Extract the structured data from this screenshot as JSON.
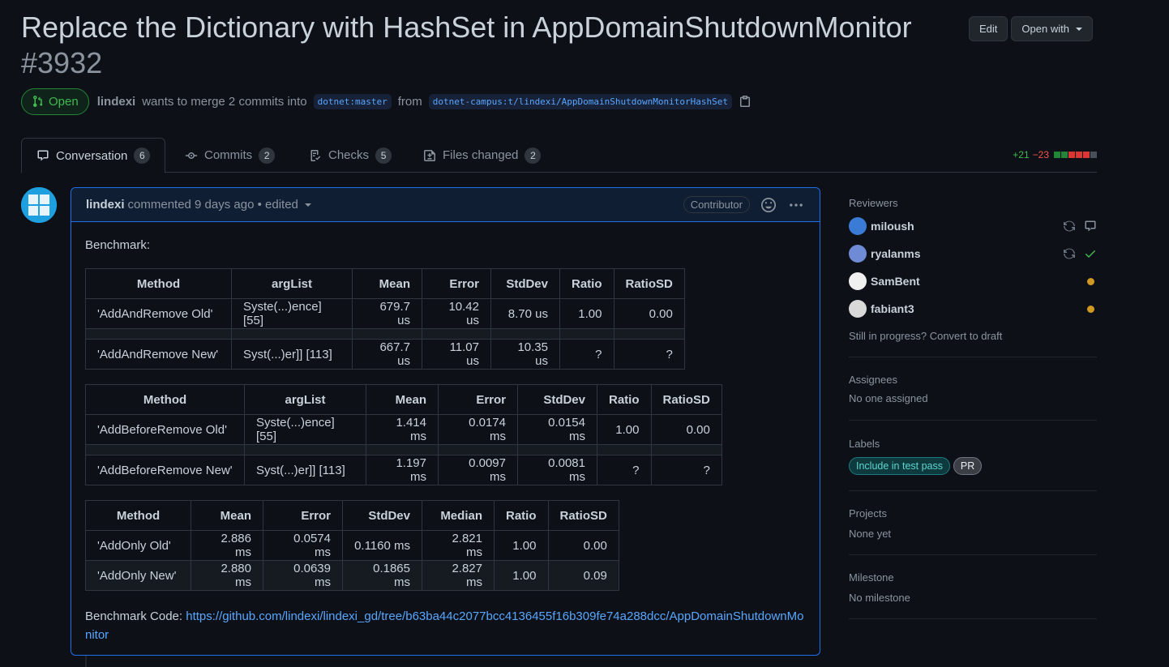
{
  "pr": {
    "title": "Replace the Dictionary with HashSet in AppDomainShutdownMonitor",
    "number": "#3932",
    "state": "Open",
    "author": "lindexi",
    "merge_text": "wants to merge 2 commits into",
    "base_branch": "dotnet:master",
    "from_text": "from",
    "head_branch": "dotnet-campus:t/lindexi/AppDomainShutdownMonitorHashSet"
  },
  "header_actions": {
    "edit": "Edit",
    "open_with": "Open with"
  },
  "tabs": [
    {
      "label": "Conversation",
      "count": "6",
      "icon": "comment-icon"
    },
    {
      "label": "Commits",
      "count": "2",
      "icon": "commit-icon"
    },
    {
      "label": "Checks",
      "count": "5",
      "icon": "checklist-icon"
    },
    {
      "label": "Files changed",
      "count": "2",
      "icon": "file-diff-icon"
    }
  ],
  "diffstat": {
    "additions": "+21",
    "deletions": "−23",
    "colors": [
      "#238636",
      "#238636",
      "#da3633",
      "#da3633",
      "#da3633",
      "#484f58"
    ]
  },
  "comment": {
    "author": "lindexi",
    "meta": "commented 9 days ago • edited",
    "badge": "Contributor",
    "intro": "Benchmark:",
    "code_label": "Benchmark Code:",
    "code_link": "https://github.com/lindexi/lindexi_gd/tree/b63ba44c2077bcc4136455f16b309fe74a288dcc/AppDomainShutdownMonitor"
  },
  "tables": {
    "t1": {
      "headers": [
        "Method",
        "argList",
        "Mean",
        "Error",
        "StdDev",
        "Ratio",
        "RatioSD"
      ],
      "rows": [
        [
          "'AddAndRemove Old'",
          "Syste(...)ence] [55]",
          "679.7 us",
          "10.42 us",
          "8.70 us",
          "1.00",
          "0.00"
        ],
        [
          "'AddAndRemove New'",
          "Syst(...)er]] [113]",
          "667.7 us",
          "11.07 us",
          "10.35 us",
          "?",
          "?"
        ]
      ]
    },
    "t2": {
      "headers": [
        "Method",
        "argList",
        "Mean",
        "Error",
        "StdDev",
        "Ratio",
        "RatioSD"
      ],
      "rows": [
        [
          "'AddBeforeRemove Old'",
          "Syste(...)ence] [55]",
          "1.414 ms",
          "0.0174 ms",
          "0.0154 ms",
          "1.00",
          "0.00"
        ],
        [
          "'AddBeforeRemove New'",
          "Syst(...)er]] [113]",
          "1.197 ms",
          "0.0097 ms",
          "0.0081 ms",
          "?",
          "?"
        ]
      ]
    },
    "t3": {
      "headers": [
        "Method",
        "Mean",
        "Error",
        "StdDev",
        "Median",
        "Ratio",
        "RatioSD"
      ],
      "rows": [
        [
          "'AddOnly Old'",
          "2.886 ms",
          "0.0574 ms",
          "0.1160 ms",
          "2.821 ms",
          "1.00",
          "0.00"
        ],
        [
          "'AddOnly New'",
          "2.880 ms",
          "0.0639 ms",
          "0.1865 ms",
          "2.827 ms",
          "1.00",
          "0.09"
        ]
      ]
    }
  },
  "sidebar": {
    "reviewers_title": "Reviewers",
    "reviewers": [
      {
        "name": "miloush",
        "status": "re-request + comment"
      },
      {
        "name": "ryalanms",
        "status": "re-request + approved"
      },
      {
        "name": "SamBent",
        "status": "pending"
      },
      {
        "name": "fabiant3",
        "status": "pending"
      }
    ],
    "draft_text": "Still in progress? Convert to draft",
    "assignees_title": "Assignees",
    "assignees_value": "No one assigned",
    "labels_title": "Labels",
    "labels": [
      {
        "name": "Include in test pass",
        "color": "#1b7c83"
      },
      {
        "name": "PR",
        "color": "#3b3f45"
      }
    ],
    "projects_title": "Projects",
    "projects_value": "None yet",
    "milestone_title": "Milestone",
    "milestone_value": "No milestone"
  }
}
